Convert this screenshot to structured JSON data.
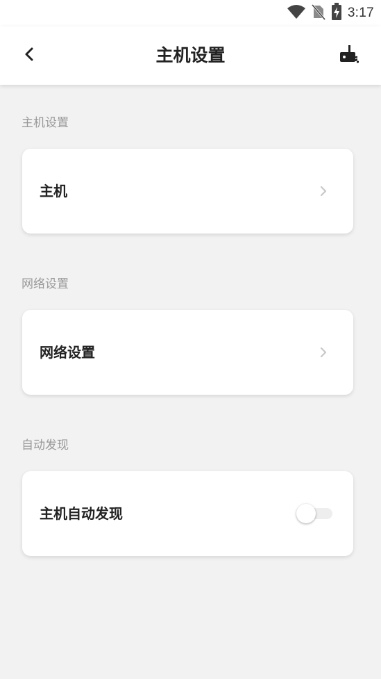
{
  "status_bar": {
    "time": "3:17",
    "icons": [
      "wifi-icon",
      "no-sim-icon",
      "battery-charging-icon"
    ]
  },
  "header": {
    "title": "主机设置",
    "back_icon": "chevron-left-icon",
    "action_icon": "host-device-icon"
  },
  "sections": [
    {
      "label": "主机设置",
      "item_label": "主机",
      "control": "chevron-right-icon"
    },
    {
      "label": "网络设置",
      "item_label": "网络设置",
      "control": "chevron-right-icon"
    },
    {
      "label": "自动发现",
      "item_label": "主机自动发现",
      "control": "toggle",
      "toggle_on": false
    }
  ],
  "colors": {
    "background": "#f2f2f2",
    "card": "#ffffff",
    "section_label": "#999999",
    "title": "#222222"
  }
}
